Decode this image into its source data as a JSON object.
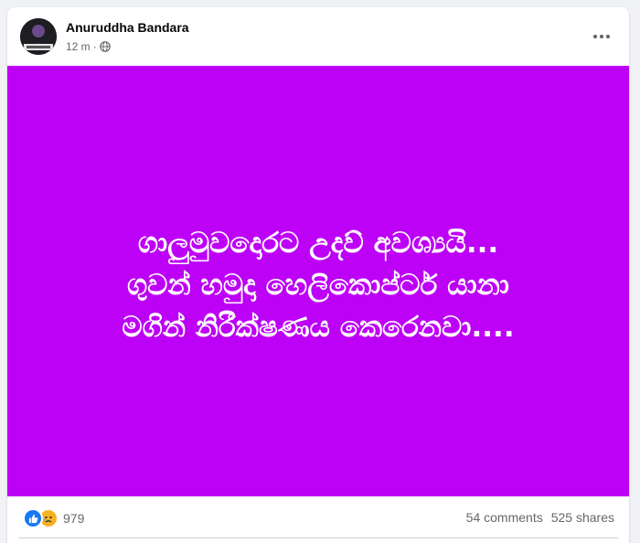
{
  "post": {
    "author": "Anuruddha Bandara",
    "time": "12 m",
    "separator": "·",
    "privacy_icon": "globe-icon",
    "more_icon": "more-horizontal-icon",
    "background_color": "#bd00f6",
    "text_lines": [
      "ගාලුමුවදොරට උදව් අවශ්‍යයි...",
      "ගුවන් හමුදා හෙලිකොප්ටර් යානා",
      "මගින් නිරීක්ෂණය කෙරෙනවා...."
    ]
  },
  "reactions": {
    "icons": [
      "like-icon",
      "sad-icon"
    ],
    "count": "979"
  },
  "stats": {
    "comments": "54 comments",
    "shares": "525 shares"
  }
}
